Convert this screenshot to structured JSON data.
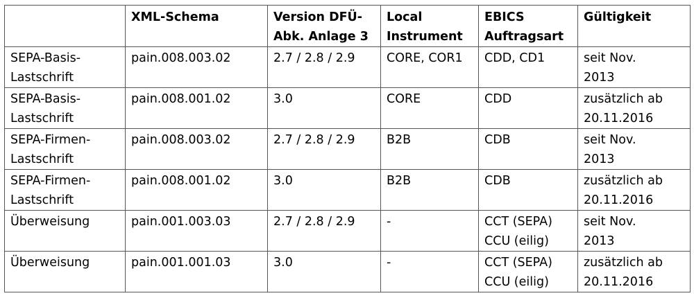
{
  "table": {
    "headers": [
      [
        ""
      ],
      [
        "XML-Schema"
      ],
      [
        "Version DFÜ-",
        "Abk. Anlage 3"
      ],
      [
        "Local",
        "Instrument"
      ],
      [
        "EBICS",
        "Auftragsart"
      ],
      [
        "Gültigkeit"
      ]
    ],
    "rows": [
      [
        [
          "SEPA-Basis-",
          "Lastschrift"
        ],
        [
          "pain.008.003.02"
        ],
        [
          "2.7 / 2.8 / 2.9"
        ],
        [
          "CORE, COR1"
        ],
        [
          "CDD, CD1"
        ],
        [
          "seit Nov.",
          "2013"
        ]
      ],
      [
        [
          "SEPA-Basis-",
          "Lastschrift"
        ],
        [
          "pain.008.001.02"
        ],
        [
          "3.0"
        ],
        [
          "CORE"
        ],
        [
          "CDD"
        ],
        [
          "zusätzlich ab",
          "20.11.2016"
        ]
      ],
      [
        [
          "SEPA-Firmen-",
          "Lastschrift"
        ],
        [
          "pain.008.003.02"
        ],
        [
          "2.7 / 2.8 / 2.9"
        ],
        [
          "B2B"
        ],
        [
          "CDB"
        ],
        [
          "seit Nov.",
          "2013"
        ]
      ],
      [
        [
          "SEPA-Firmen-",
          "Lastschrift"
        ],
        [
          "pain.008.001.02"
        ],
        [
          "3.0"
        ],
        [
          "B2B"
        ],
        [
          "CDB"
        ],
        [
          "zusätzlich ab",
          "20.11.2016"
        ]
      ],
      [
        [
          "Überweisung"
        ],
        [
          "pain.001.003.03"
        ],
        [
          "2.7 / 2.8 / 2.9"
        ],
        [
          "-"
        ],
        [
          "CCT (SEPA)",
          "CCU (eilig)"
        ],
        [
          "seit Nov.",
          "2013"
        ]
      ],
      [
        [
          "Überweisung"
        ],
        [
          "pain.001.001.03"
        ],
        [
          "3.0"
        ],
        [
          "-"
        ],
        [
          "CCT (SEPA)",
          "CCU (eilig)"
        ],
        [
          "zusätzlich ab",
          "20.11.2016"
        ]
      ]
    ]
  }
}
